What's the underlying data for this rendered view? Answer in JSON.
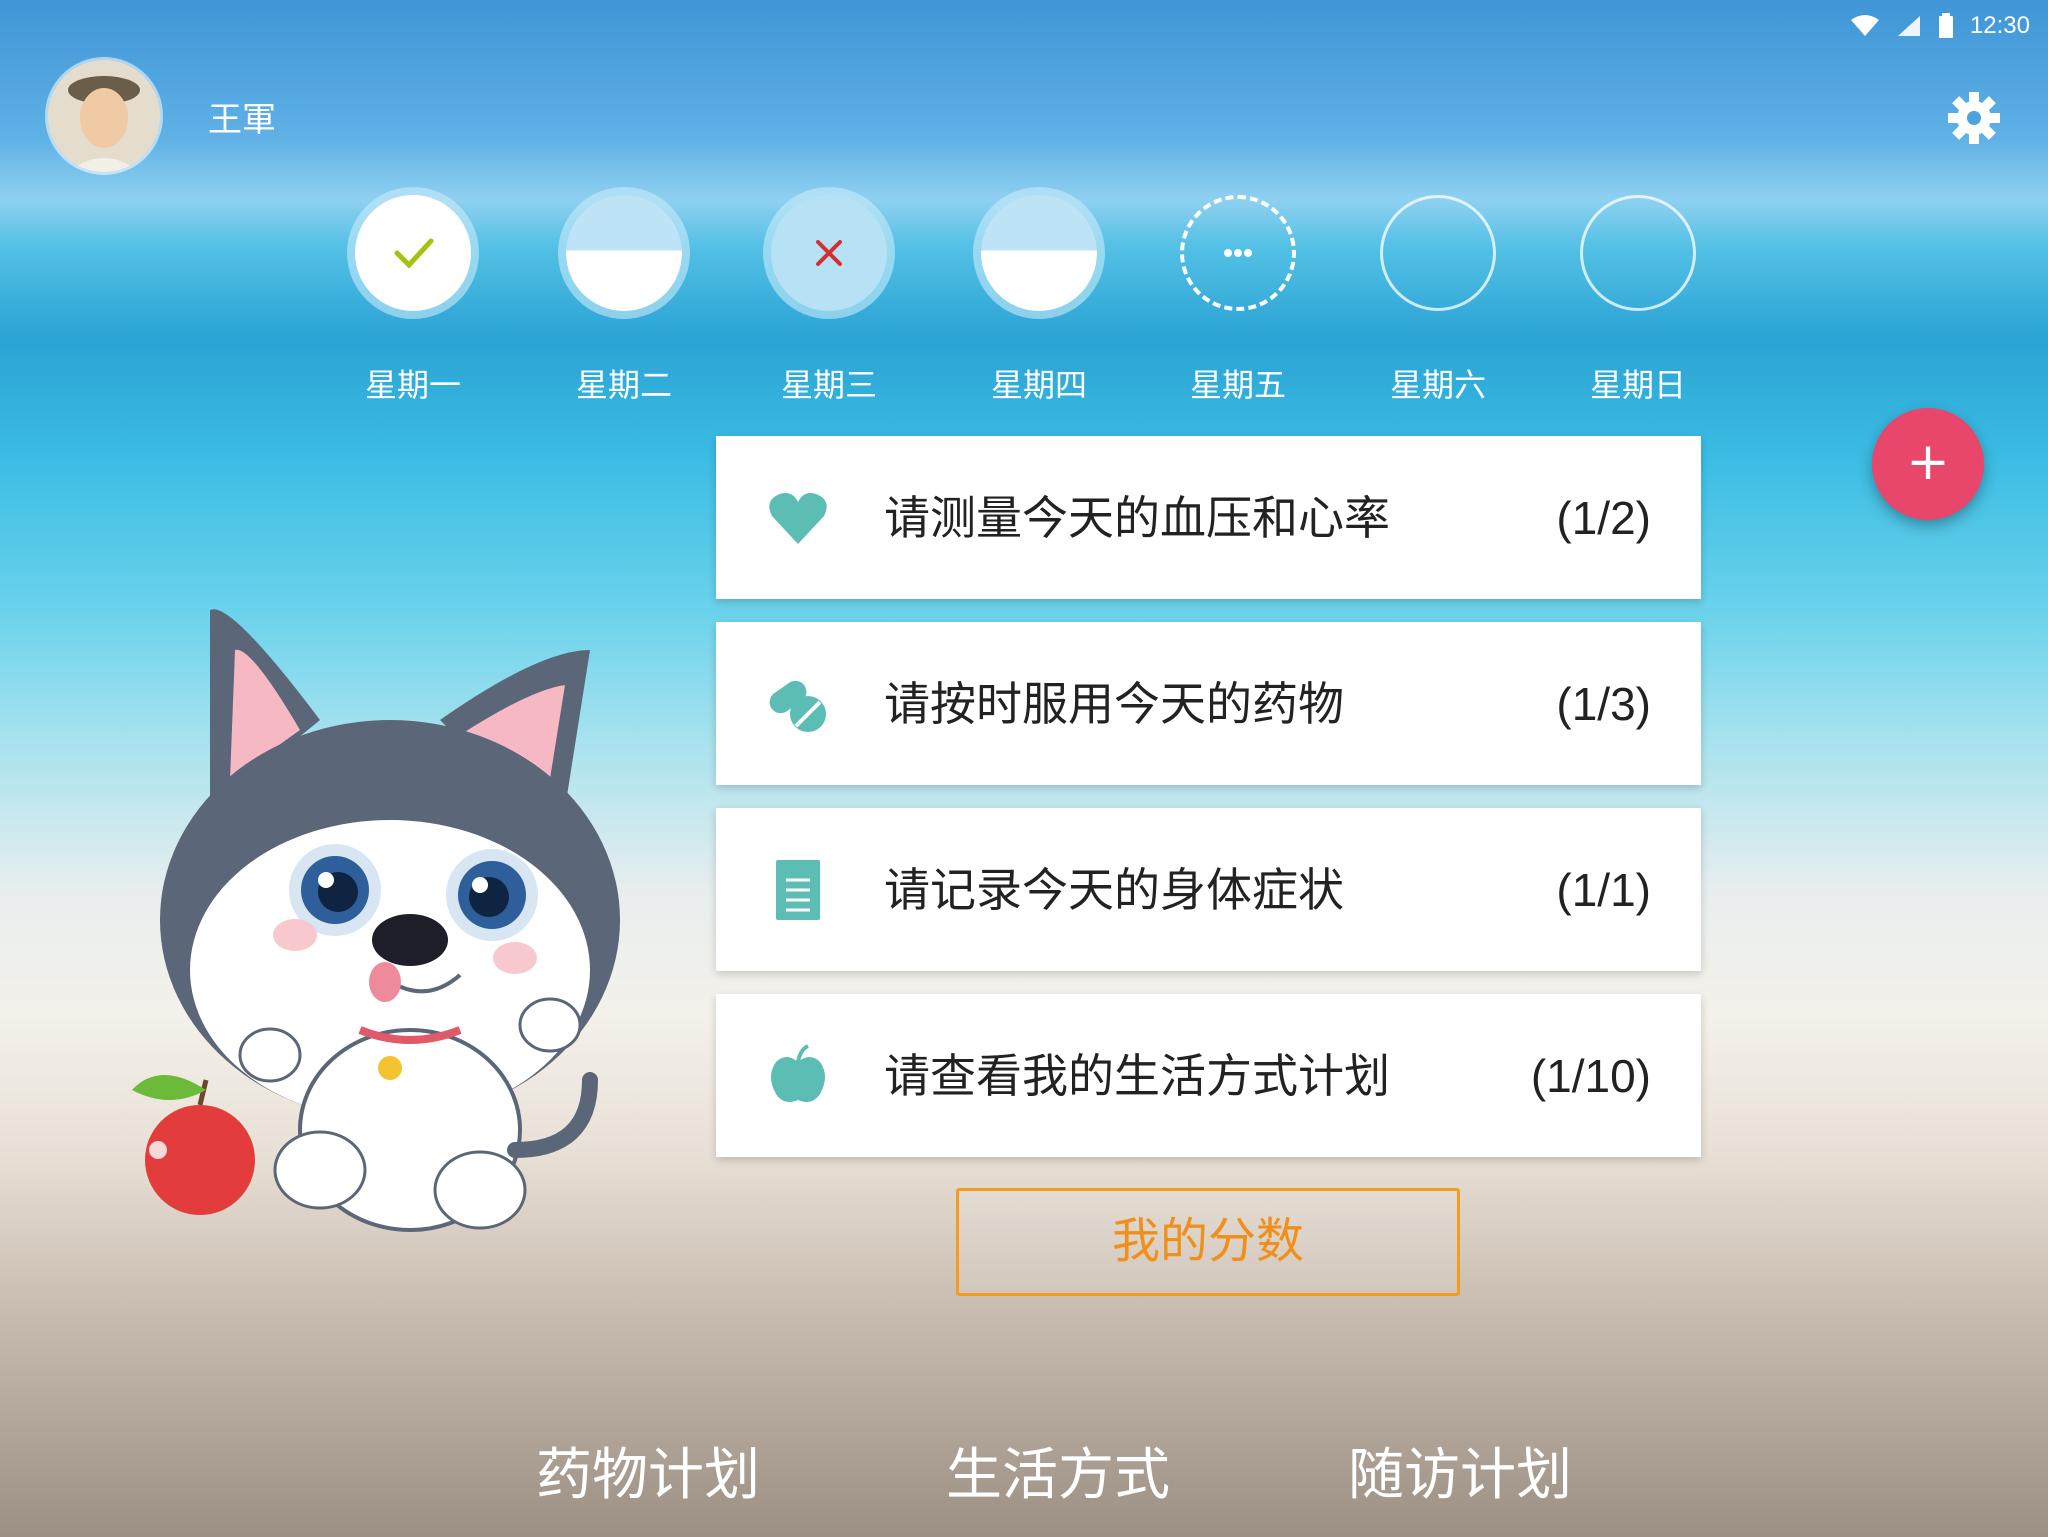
{
  "status": {
    "time": "12:30",
    "icons": [
      "wifi-icon",
      "signal-icon",
      "battery-icon"
    ]
  },
  "user": {
    "name": "王軍"
  },
  "days": [
    {
      "label": "星期一",
      "state": "done"
    },
    {
      "label": "星期二",
      "state": "half"
    },
    {
      "label": "星期三",
      "state": "missed"
    },
    {
      "label": "星期四",
      "state": "half"
    },
    {
      "label": "星期五",
      "state": "in-progress"
    },
    {
      "label": "星期六",
      "state": "empty"
    },
    {
      "label": "星期日",
      "state": "empty"
    }
  ],
  "tasks": [
    {
      "icon": "heart-icon",
      "text": "请测量今天的血压和心率",
      "count": "(1/2)"
    },
    {
      "icon": "pill-icon",
      "text": "请按时服用今天的药物",
      "count": "(1/3)"
    },
    {
      "icon": "document-icon",
      "text": "请记录今天的身体症状",
      "count": "(1/1)"
    },
    {
      "icon": "apple-icon",
      "text": "请查看我的生活方式计划",
      "count": "(1/10)"
    }
  ],
  "fab": {
    "label": "+"
  },
  "score_button": {
    "label": "我的分数"
  },
  "bottom_nav": {
    "items": [
      "药物计划",
      "生活方式",
      "随访计划"
    ]
  },
  "colors": {
    "accent": "#5bbdb3",
    "fab": "#e8466a",
    "score": "#f39c20",
    "missed": "#d32f2f",
    "done": "#a6c20f"
  }
}
